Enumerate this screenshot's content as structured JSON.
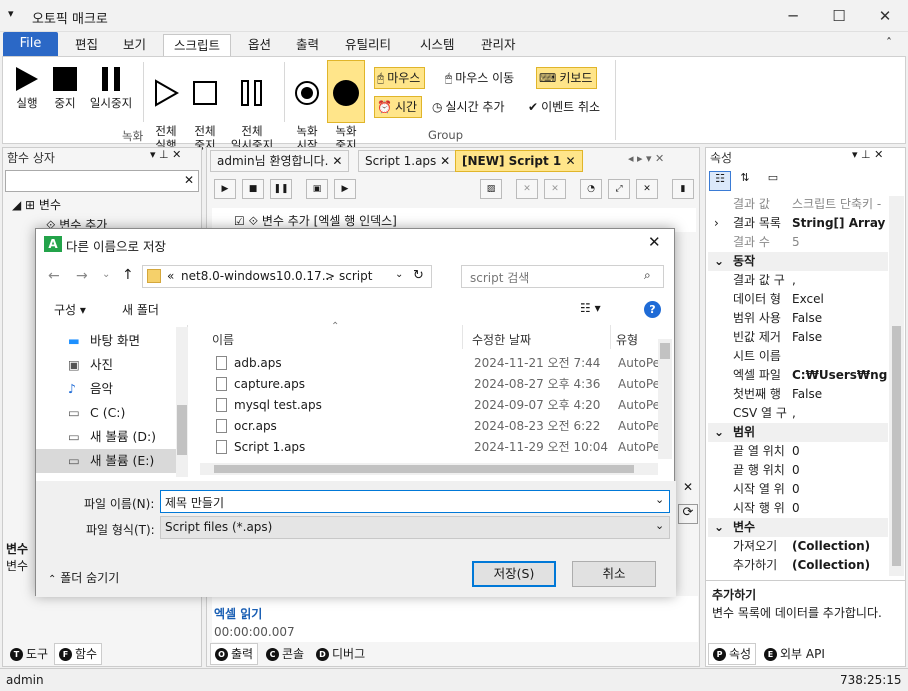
{
  "window": {
    "title": "오토픽 매크로",
    "menu_glyph": "▾",
    "min": "─",
    "max": "☐",
    "close": "✕",
    "collapse": "ˆ"
  },
  "ribbon_tabs": {
    "file": "File",
    "t1": "편집",
    "t2": "보기",
    "t3": "스크립트",
    "t4": "옵션",
    "t5": "출력",
    "t6": "유틸리티",
    "t7": "시스템",
    "t8": "관리자"
  },
  "ribbon": {
    "run": "실행",
    "stop": "중지",
    "pause": "일시중지",
    "all_run": "전체\n실행",
    "all_stop": "전체\n중지",
    "all_pause": "전체\n일시중지",
    "rec_start": "녹화\n시작",
    "rec_stop": "녹화\n중지",
    "mouse": "마우스",
    "mouse_move": "마우스 이동",
    "keyboard": "키보드",
    "time": "시간",
    "realtime_add": "실시간 추가",
    "event_cancel": "이벤트 취소",
    "group_rec": "녹화",
    "group_group": "Group"
  },
  "left_panel": {
    "title": "함수 상자",
    "tree_var": "변수",
    "tree_var_add": "변수 추가",
    "bottom_label": "변수",
    "bottom_label2": "변수",
    "tab_tool": "도구",
    "tab_func": "함수"
  },
  "doc_tabs": {
    "welcome": "admin님 환영합니다.",
    "script1": "Script 1.aps",
    "new_script": "[NEW] Script 1"
  },
  "editor": {
    "line1": "변수 추가 [엑셀 행 인덱스]",
    "output_title": "엑셀 읽기",
    "output_time": "00:00:00.007"
  },
  "output_tabs": {
    "output": "출력",
    "console": "콘솔",
    "debug": "디버그"
  },
  "properties": {
    "title": "속성",
    "rows": [
      {
        "k": "결과 값",
        "v": "스크립트 단축키 -",
        "dim": true
      },
      {
        "k": "결과 목록",
        "v": "String[] Array",
        "bold": true,
        "expand": true
      },
      {
        "k": "결과 수",
        "v": "5",
        "dim": true
      },
      {
        "cat": "동작"
      },
      {
        "k": "결과 값 구",
        "v": ","
      },
      {
        "k": "데이터 형",
        "v": "Excel"
      },
      {
        "k": "범위 사용",
        "v": "False"
      },
      {
        "k": "빈값 제거",
        "v": "False"
      },
      {
        "k": "시트 이름",
        "v": ""
      },
      {
        "k": "엑셀 파일",
        "v": "C:₩Users₩ngma",
        "bold": true
      },
      {
        "k": "첫번째 행",
        "v": "False"
      },
      {
        "k": "CSV 열 구",
        "v": ","
      },
      {
        "cat": "범위"
      },
      {
        "k": "끝 열 위치",
        "v": "0"
      },
      {
        "k": "끝 행 위치",
        "v": "0"
      },
      {
        "k": "시작 열 위",
        "v": "0"
      },
      {
        "k": "시작 행 위",
        "v": "0"
      },
      {
        "cat": "변수"
      },
      {
        "k": "가져오기",
        "v": "(Collection)",
        "bold": true
      },
      {
        "k": "추가하기",
        "v": "(Collection)",
        "bold": true
      }
    ],
    "desc_title": "추가하기",
    "desc_text": "변수 목록에 데이터를 추가합니다.",
    "tab_prop": "속성",
    "tab_api": "외부 API"
  },
  "status": {
    "user": "admin",
    "coords": "738:25:15"
  },
  "dialog": {
    "title": "다른 이름으로 저장",
    "breadcrumb_prefix": "«",
    "breadcrumb_1": "net8.0-windows10.0.17...",
    "breadcrumb_sep": ">",
    "breadcrumb_2": "script",
    "search_placeholder": "script 검색",
    "organize": "구성",
    "new_folder": "새 폴더",
    "nav": [
      "바탕 화면",
      "사진",
      "음악",
      "C (C:)",
      "새 볼륨 (D:)",
      "새 볼륨 (E:)"
    ],
    "col_name": "이름",
    "col_date": "수정한 날짜",
    "col_type": "유형",
    "files": [
      {
        "name": "adb.aps",
        "date": "2024-11-21 오전 7:44",
        "type": "AutoPea"
      },
      {
        "name": "capture.aps",
        "date": "2024-08-27 오후 4:36",
        "type": "AutoPea"
      },
      {
        "name": "mysql test.aps",
        "date": "2024-09-07 오후 4:20",
        "type": "AutoPea"
      },
      {
        "name": "ocr.aps",
        "date": "2024-08-23 오전 6:22",
        "type": "AutoPea"
      },
      {
        "name": "Script 1.aps",
        "date": "2024-11-29 오전 10:04",
        "type": "AutoPea"
      }
    ],
    "filename_label": "파일 이름(N):",
    "filename_value": "제목 만들기",
    "filetype_label": "파일 형식(T):",
    "filetype_value": "Script files (*.aps)",
    "hide_folders": "폴더 숨기기",
    "save": "저장(S)",
    "cancel": "취소"
  },
  "colors": {
    "accent": "#2b68c6",
    "highlight": "#ffe58a"
  }
}
